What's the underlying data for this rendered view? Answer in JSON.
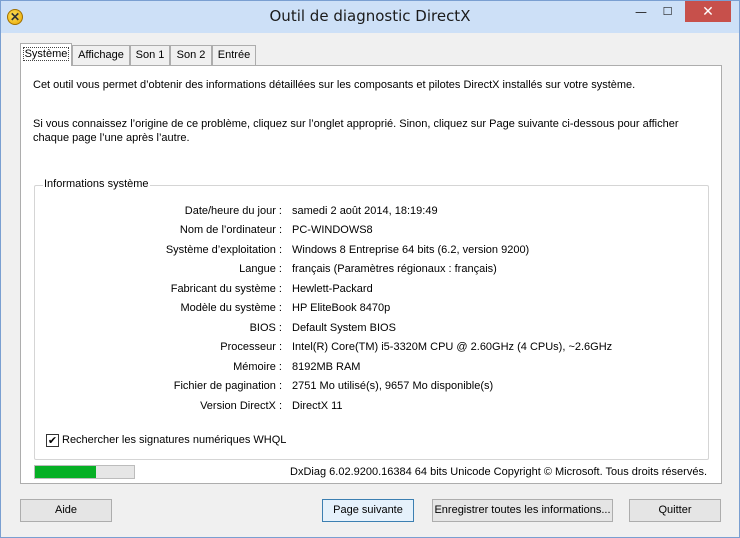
{
  "window": {
    "title": "Outil de diagnostic DirectX",
    "minimize_glyph": "—",
    "maximize_glyph": "☐",
    "close_glyph": "✕",
    "app_icon": "directx-icon"
  },
  "tabs": [
    {
      "label": "Système",
      "active": true
    },
    {
      "label": "Affichage",
      "active": false
    },
    {
      "label": "Son 1",
      "active": false
    },
    {
      "label": "Son 2",
      "active": false
    },
    {
      "label": "Entrée",
      "active": false
    }
  ],
  "intro": {
    "line1": "Cet outil vous permet d’obtenir des informations détaillées sur les composants et pilotes DirectX installés sur votre système.",
    "line2": "Si vous connaissez l’origine de ce problème, cliquez sur l’onglet approprié. Sinon, cliquez sur Page suivante ci-dessous pour afficher chaque page l’une après l’autre."
  },
  "system_info": {
    "group_label": "Informations système",
    "rows": [
      {
        "label": "Date/heure du jour :",
        "value": "samedi 2 août 2014, 18:19:49"
      },
      {
        "label": "Nom de l’ordinateur :",
        "value": "PC-WINDOWS8"
      },
      {
        "label": "Système d’exploitation :",
        "value": "Windows 8 Entreprise 64 bits (6.2, version 9200)"
      },
      {
        "label": "Langue :",
        "value": "français (Paramètres régionaux : français)"
      },
      {
        "label": "Fabricant du système :",
        "value": "Hewlett-Packard"
      },
      {
        "label": "Modèle du système :",
        "value": "HP EliteBook 8470p"
      },
      {
        "label": "BIOS :",
        "value": "Default System BIOS"
      },
      {
        "label": "Processeur :",
        "value": "Intel(R) Core(TM) i5-3320M CPU @ 2.60GHz (4 CPUs), ~2.6GHz"
      },
      {
        "label": "Mémoire :",
        "value": "8192MB RAM"
      },
      {
        "label": "Fichier de pagination :",
        "value": "2751 Mo utilisé(s), 9657 Mo disponible(s)"
      },
      {
        "label": "Version DirectX :",
        "value": "DirectX 11"
      }
    ]
  },
  "whql_checkbox": {
    "label": "Rechercher les signatures numériques WHQL",
    "checked": true,
    "glyph": "✔"
  },
  "progress": {
    "fraction": 0.62,
    "color": "#06b025"
  },
  "copyright": "DxDiag 6.02.9200.16384 64 bits Unicode Copyright © Microsoft. Tous droits réservés.",
  "buttons": {
    "help": "Aide",
    "next_page": "Page suivante",
    "save_all": "Enregistrer toutes les informations...",
    "quit": "Quitter"
  }
}
